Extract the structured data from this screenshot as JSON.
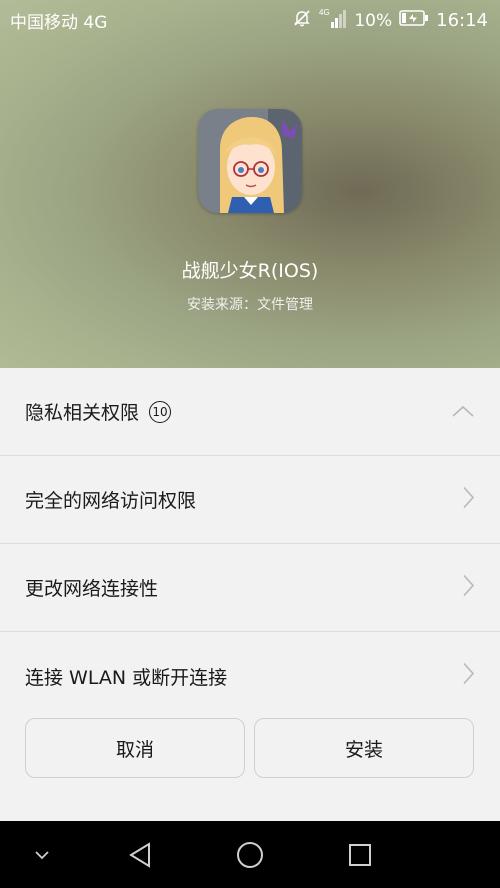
{
  "status_bar": {
    "carrier": "中国移动 4G",
    "battery_percent": "10%",
    "time": "16:14",
    "icons": [
      "mute-icon",
      "signal-4g-icon",
      "battery-charging-icon"
    ]
  },
  "app": {
    "name": "战舰少女R(IOS)",
    "source": "安装来源：文件管理"
  },
  "permissions": {
    "group_label": "隐私相关权限",
    "group_count": "10",
    "items": [
      {
        "label": "完全的网络访问权限"
      },
      {
        "label": "更改网络连接性"
      },
      {
        "label": "连接 WLAN 或断开连接"
      }
    ]
  },
  "actions": {
    "cancel_label": "取消",
    "install_label": "安装"
  },
  "nav_bar": {
    "icons": [
      "collapse-icon",
      "back-icon",
      "home-icon",
      "recents-icon"
    ]
  }
}
